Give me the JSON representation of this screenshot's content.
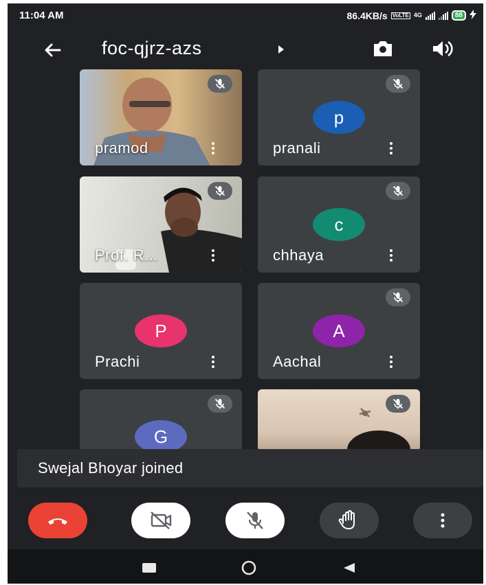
{
  "status_bar": {
    "time": "11:04 AM",
    "network_speed": "86.4KB/s",
    "network_type": "4G",
    "battery": "88"
  },
  "meeting": {
    "code": "foc-qjrz-azs"
  },
  "participants": [
    {
      "name": "pramod",
      "avatar_letter": "",
      "avatar_color": "",
      "video": true,
      "muted": true
    },
    {
      "name": "pranali",
      "avatar_letter": "p",
      "avatar_color": "#1a5fb4",
      "video": false,
      "muted": true
    },
    {
      "name": "Prof. R...",
      "avatar_letter": "",
      "avatar_color": "",
      "video": true,
      "muted": true
    },
    {
      "name": "chhaya",
      "avatar_letter": "c",
      "avatar_color": "#138a72",
      "video": false,
      "muted": true
    },
    {
      "name": "Prachi",
      "avatar_letter": "P",
      "avatar_color": "#e8336d",
      "video": false,
      "muted": false
    },
    {
      "name": "Aachal",
      "avatar_letter": "A",
      "avatar_color": "#8e24aa",
      "video": false,
      "muted": true
    },
    {
      "name": "",
      "avatar_letter": "G",
      "avatar_color": "#5c6bc0",
      "video": false,
      "muted": true
    },
    {
      "name": "",
      "avatar_letter": "",
      "avatar_color": "",
      "video": true,
      "muted": true
    }
  ],
  "toast": {
    "message": "Swejal Bhoyar joined"
  },
  "controls": {
    "end_call_color": "#ea4335",
    "camera": "off",
    "microphone": "off",
    "raise_hand": "inactive"
  },
  "icons": {
    "back": "arrow-left-icon",
    "title_caret": "caret-right-icon",
    "switch_camera": "switch-camera-icon",
    "speaker": "speaker-icon",
    "mic_off": "mic-off-icon",
    "camera_off": "camera-off-icon",
    "end_call": "phone-hangup-icon",
    "hand": "hand-icon",
    "more": "more-vert-icon"
  }
}
